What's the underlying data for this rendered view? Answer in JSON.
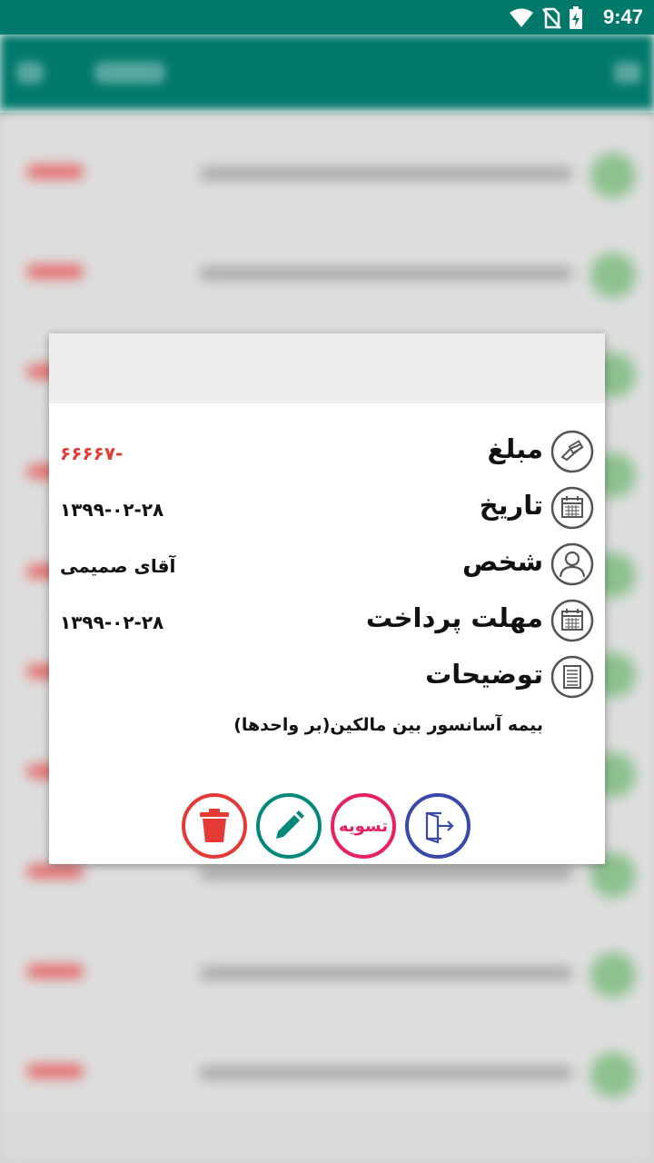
{
  "status_bar": {
    "time": "9:47",
    "icons": [
      "wifi-icon",
      "no-sim-icon",
      "battery-charging-icon"
    ]
  },
  "dialog": {
    "fields": [
      {
        "icon": "money-hand-icon",
        "label": "مبلغ",
        "value": "-۶۶۶۶۷",
        "value_color": "#e53935"
      },
      {
        "icon": "calendar-icon",
        "label": "تاریخ",
        "value": "۱۳۹۹-۰۲-۲۸"
      },
      {
        "icon": "person-icon",
        "label": "شخص",
        "value": "آقای صمیمی"
      },
      {
        "icon": "calendar-icon",
        "label": "مهلت پرداخت",
        "value": "۱۳۹۹-۰۲-۲۸"
      },
      {
        "icon": "notes-icon",
        "label": "توضیحات",
        "value": ""
      }
    ],
    "description": "بیمه آسانسور بین مالکین(بر واحدها)",
    "actions": {
      "delete_icon": "trash-icon",
      "edit_icon": "pencil-icon",
      "settle_label": "تسویه",
      "exit_icon": "exit-icon"
    }
  },
  "colors": {
    "primary": "#00796b",
    "negative": "#e53935",
    "settle": "#e91e63",
    "exit": "#3949ab",
    "edit": "#00897b"
  }
}
